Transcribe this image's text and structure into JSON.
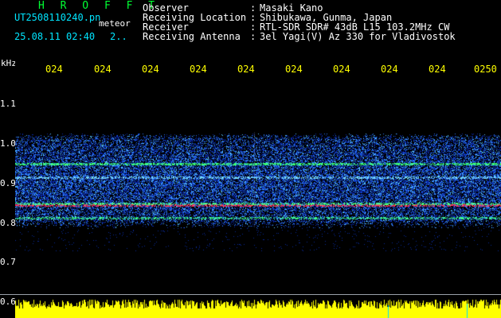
{
  "header": {
    "brand": "H R O F F T",
    "filename": "UT2508110240.pn",
    "meteor_label": "meteor",
    "datetime": "25.08.11 02:40",
    "extra": "2..",
    "rows": [
      {
        "label": "Observer",
        "sep": ":",
        "value": "Masaki Kano"
      },
      {
        "label": "Receiving Location",
        "sep": ":",
        "value": "Shibukawa, Gunma, Japan"
      },
      {
        "label": "Receiver",
        "sep": ":",
        "value": "RTL-SDR SDR# 43dB L15 103.2MHz CW"
      },
      {
        "label": "Receiving Antenna",
        "sep": ":",
        "value": "3el Yagi(V) Az 330 for Vladivostok"
      }
    ]
  },
  "axis": {
    "unit": "kHz",
    "y_labels": [
      "1.1",
      "1.0",
      "0.9",
      "0.8",
      "0.7",
      "0.6"
    ],
    "x_labels": [
      "024",
      "024",
      "024",
      "024",
      "024",
      "024",
      "024",
      "024",
      "024",
      "0250"
    ]
  },
  "colors": {
    "background": "#000000",
    "noise_low": "#0a2cb4",
    "noise_mid": "#3a8cff",
    "signal_cyan": "#00e0ff",
    "signal_green": "#33ff66",
    "signal_red": "#ff3060",
    "power_bar": "#ffff00"
  }
}
